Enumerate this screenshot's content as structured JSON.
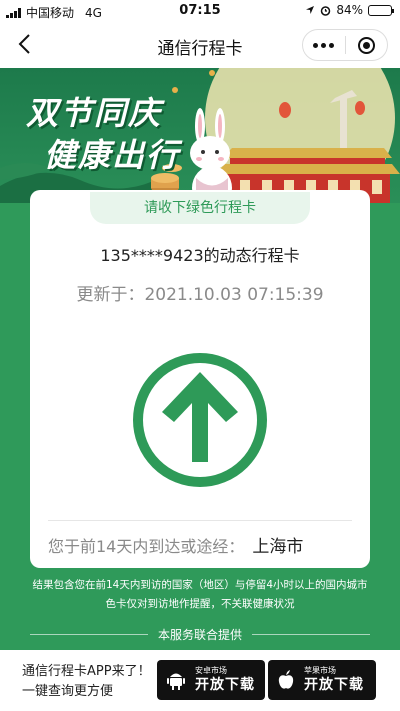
{
  "status_bar": {
    "carrier": "中国移动",
    "network": "4G",
    "time": "07:15",
    "battery_percent": "84%",
    "battery_level": 0.84
  },
  "nav": {
    "title": "通信行程卡"
  },
  "banner": {
    "line1": "双节同庆",
    "line2": "健康出行"
  },
  "card": {
    "tab_label": "请收下绿色行程卡",
    "phone_text": "135****9423的动态行程卡",
    "update_label": "更新于：",
    "update_time": "2021.10.03 07:15:39",
    "status_color": "#2e9a58",
    "route_label": "您于前14天内到达或途经：",
    "route_city": "上海市"
  },
  "notes": {
    "line1": "结果包含您在前14天内到访的国家（地区）与停留4小时以上的国内城市",
    "line2": "色卡仅对到访地作提醒，不关联健康状况",
    "provider": "本服务联合提供"
  },
  "bottom": {
    "promo_line1": "通信行程卡APP来了！",
    "promo_line2": "一键查询更方便",
    "android_small": "安卓市场",
    "android_big": "开放下载",
    "apple_small": "苹果市场",
    "apple_big": "开放下载"
  },
  "colors": {
    "background": "#2f9a5a",
    "accent": "#2e9a58"
  }
}
